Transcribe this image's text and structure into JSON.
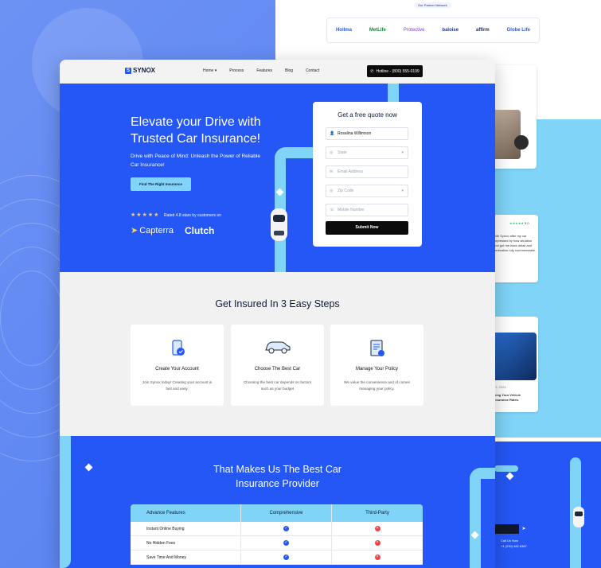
{
  "partners": {
    "tag": "Our Partner Network",
    "logos": [
      "Hollma",
      "MetLife",
      "Protective",
      "baloise",
      "affirm",
      "Globe Life"
    ]
  },
  "back_snippets": {
    "agents_text": "agents will",
    "rating_value": "5.0",
    "review_text": "with Synox after my car impressed by how situation and got me back detail and dedication ruly commendable.",
    "article_date": "03, 2024",
    "article_title": "iving Your Vehicle Insurance Rates.",
    "phone_label": "Call Us Now",
    "phone": "+1 (230) 482 6387"
  },
  "nav": {
    "brand": "SYNOX",
    "menu": [
      "Home ▾",
      "Process",
      "Features",
      "Blog",
      "Contact"
    ],
    "hotline": "Hotline - (800) 555-0199"
  },
  "hero": {
    "title": "Elevate your Drive with Trusted Car Insurance!",
    "subtitle": "Drive with Peace of Mind: Unleash the Power of Reliable Car Insurance!",
    "cta": "Find The Right Insurance",
    "stars": "★★★★★",
    "rating": "Rated 4.8 stars by customers on",
    "capterra": "Capterra",
    "clutch": "Clutch"
  },
  "quote_form": {
    "title": "Get a free quote now",
    "name_value": "Rosalina Willimson",
    "state_placeholder": "State",
    "email_placeholder": "Email Address",
    "zip_placeholder": "Zip Code",
    "mobile_placeholder": "Mobile Number",
    "submit": "Submit Now"
  },
  "steps": {
    "title": "Get Insured In 3 Easy Steps",
    "items": [
      {
        "name": "Create Your Account",
        "desc": "Join Synox today! Creating your account is fast and easy."
      },
      {
        "name": "Choose The Best Car",
        "desc": "Choosing the best car depends on factors such as your budget"
      },
      {
        "name": "Manage Your Policy",
        "desc": "We value the convenience and of comes managing your policy."
      }
    ]
  },
  "best": {
    "title_line1": "That Makes Us The Best Car",
    "title_line2": "Insurance Provider",
    "headers": [
      "Advance Features",
      "Comprehensive",
      "Third-Party"
    ],
    "rows": [
      {
        "feature": "Instant Online Buying",
        "comprehensive": true,
        "third_party": false
      },
      {
        "feature": "No Hidden Fees",
        "comprehensive": true,
        "third_party": false
      },
      {
        "feature": "Save Time And Money",
        "comprehensive": true,
        "third_party": false
      }
    ]
  },
  "colors": {
    "brand_blue": "#2457f5",
    "accent_cyan": "#7fd4f7",
    "dark": "#0c0c0c"
  }
}
